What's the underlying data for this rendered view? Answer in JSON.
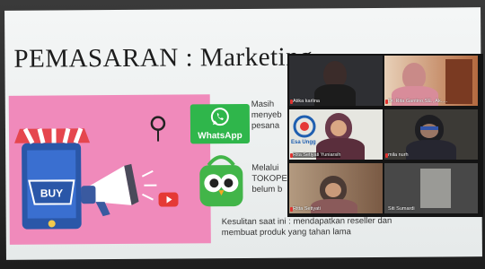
{
  "slide": {
    "title": "PEMASARAN :  Marketing",
    "text_blocks": [
      {
        "lines": [
          "Masih",
          "menyeb",
          "pesana"
        ]
      },
      {
        "lines": [
          "Melalui",
          "TOKOPE",
          "belum b"
        ]
      },
      {
        "lines": [
          "Kesulitan saat ini :  mendapatkan reseller dan",
          "membuat produk yang tahan lama"
        ]
      }
    ],
    "whatsapp_label": "WhatsApp",
    "buy_label": "BUY"
  },
  "video_call": {
    "participants": [
      {
        "name": "Atika karlina"
      },
      {
        "name": "Dr. Rita Gantino,SE., Ak.,..."
      },
      {
        "name": "Rita Setiyati Yuniarsih"
      },
      {
        "name": "mila nurh"
      },
      {
        "name": "Ritta Setiyati"
      },
      {
        "name": "Siti Sumardi"
      }
    ],
    "logo_text": "Esa Ungg"
  },
  "colors": {
    "pink_panel": "#f08abb",
    "whatsapp_green": "#2fb64b",
    "tokopedia_green": "#42b549"
  }
}
